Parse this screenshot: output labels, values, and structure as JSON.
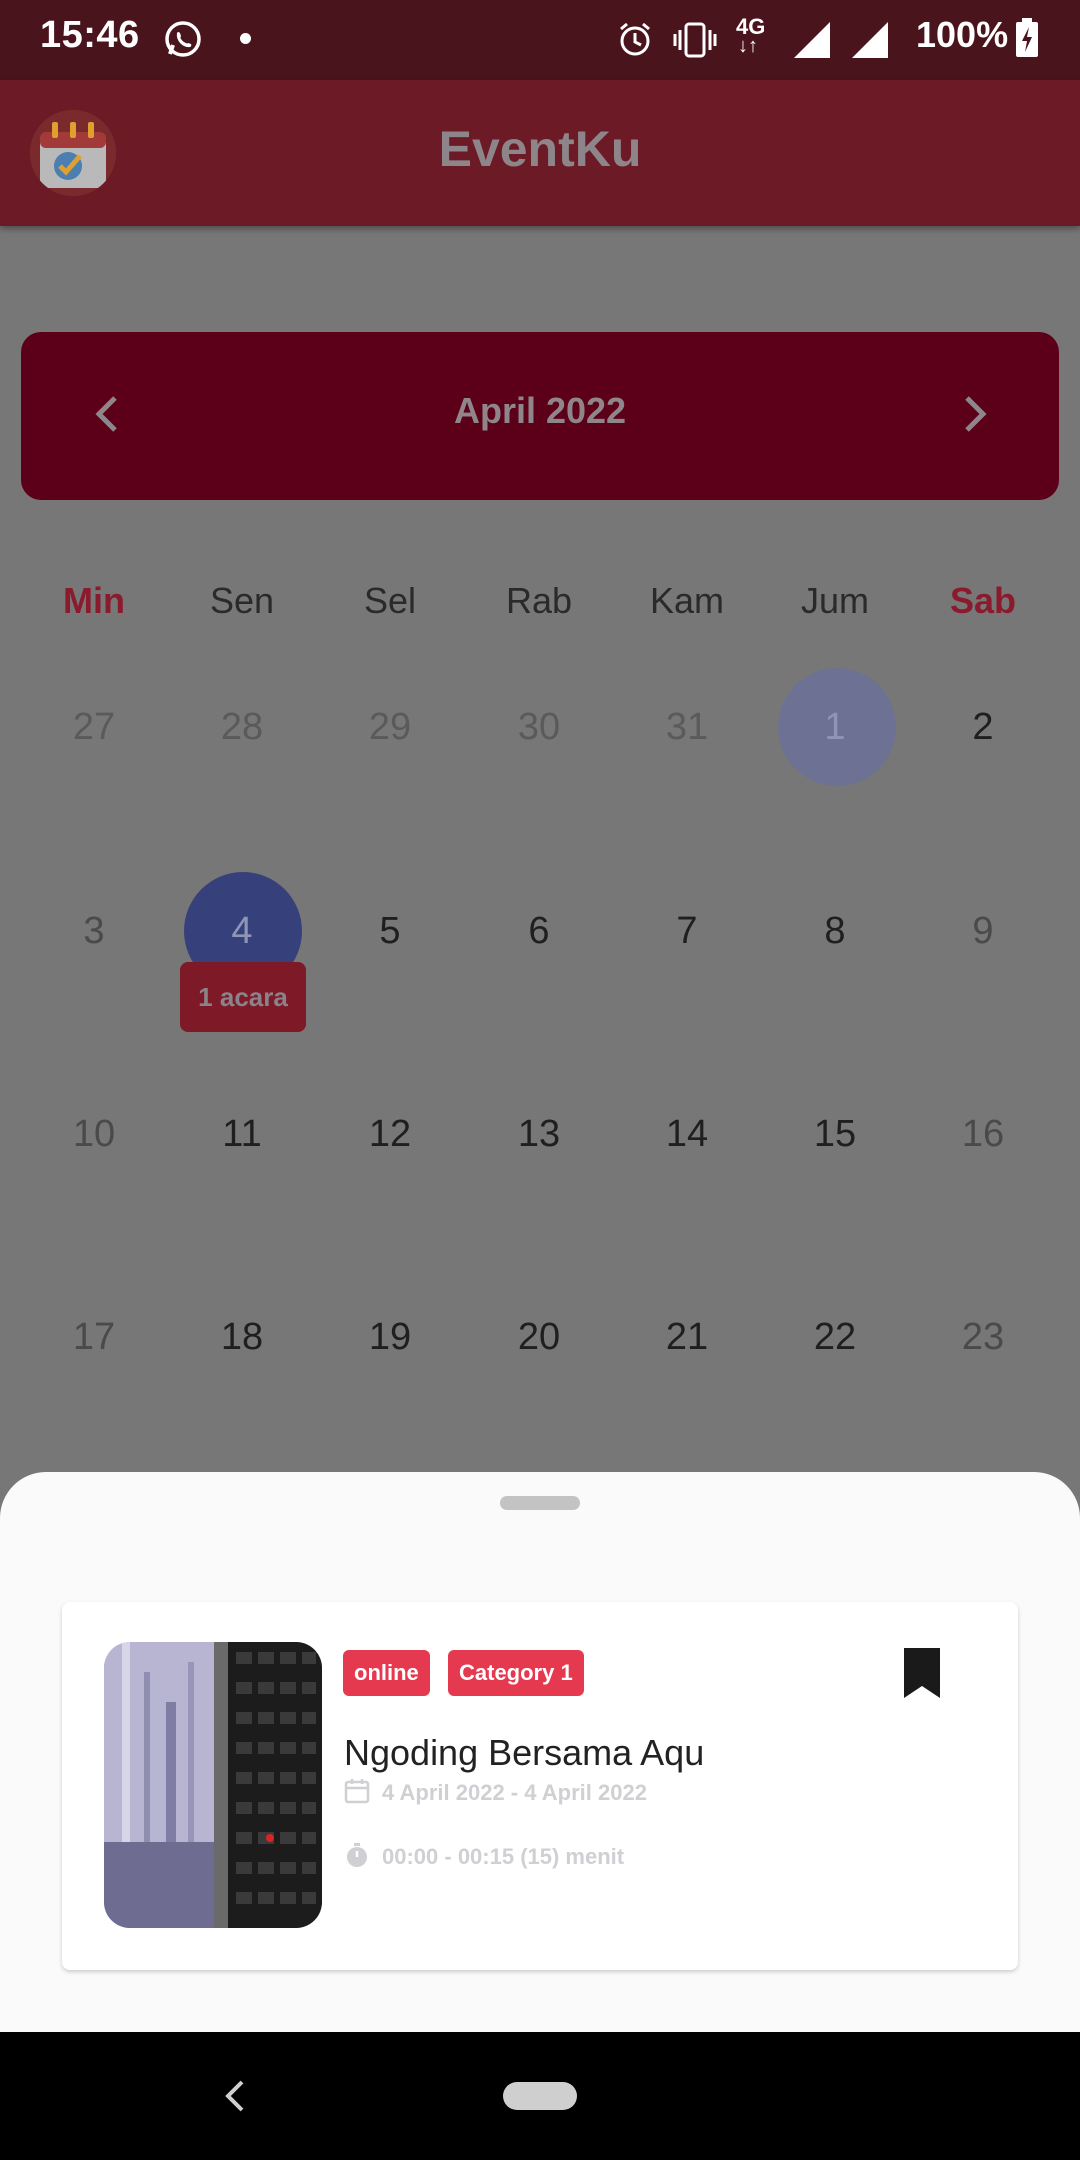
{
  "status_bar": {
    "time": "15:46",
    "network": "4G",
    "battery": "100%",
    "icons": [
      "whatsapp-icon",
      "dot-icon",
      "alarm-icon",
      "vibrate-icon",
      "signal-icon",
      "signal-icon",
      "battery-charging-icon"
    ]
  },
  "app_bar": {
    "title": "EventKu",
    "logo_icon": "calendar-check-icon"
  },
  "calendar": {
    "month_label": "April 2022",
    "prev_icon": "chevron-left-icon",
    "next_icon": "chevron-right-icon",
    "weekdays": [
      "Min",
      "Sen",
      "Sel",
      "Rab",
      "Kam",
      "Jum",
      "Sab"
    ],
    "weeks": [
      [
        "27",
        "28",
        "29",
        "30",
        "31",
        "1",
        "2"
      ],
      [
        "3",
        "4",
        "5",
        "6",
        "7",
        "8",
        "9"
      ],
      [
        "10",
        "11",
        "12",
        "13",
        "14",
        "15",
        "16"
      ],
      [
        "17",
        "18",
        "19",
        "20",
        "21",
        "22",
        "23"
      ]
    ],
    "selected_day": "4",
    "highlighted_day": "1",
    "event_badge": "1 acara",
    "colors": {
      "accent": "#5c0019",
      "weekend": "#8a1a2c",
      "selected": "#36407a"
    }
  },
  "bottom_sheet": {
    "event": {
      "tags": [
        "online",
        "Category 1"
      ],
      "title": "Ngoding Bersama Aqu",
      "date_range": "4 April 2022 - 4 April 2022",
      "time_range": "00:00 - 00:15 (15) menit",
      "chip_color": "#e53950"
    }
  }
}
